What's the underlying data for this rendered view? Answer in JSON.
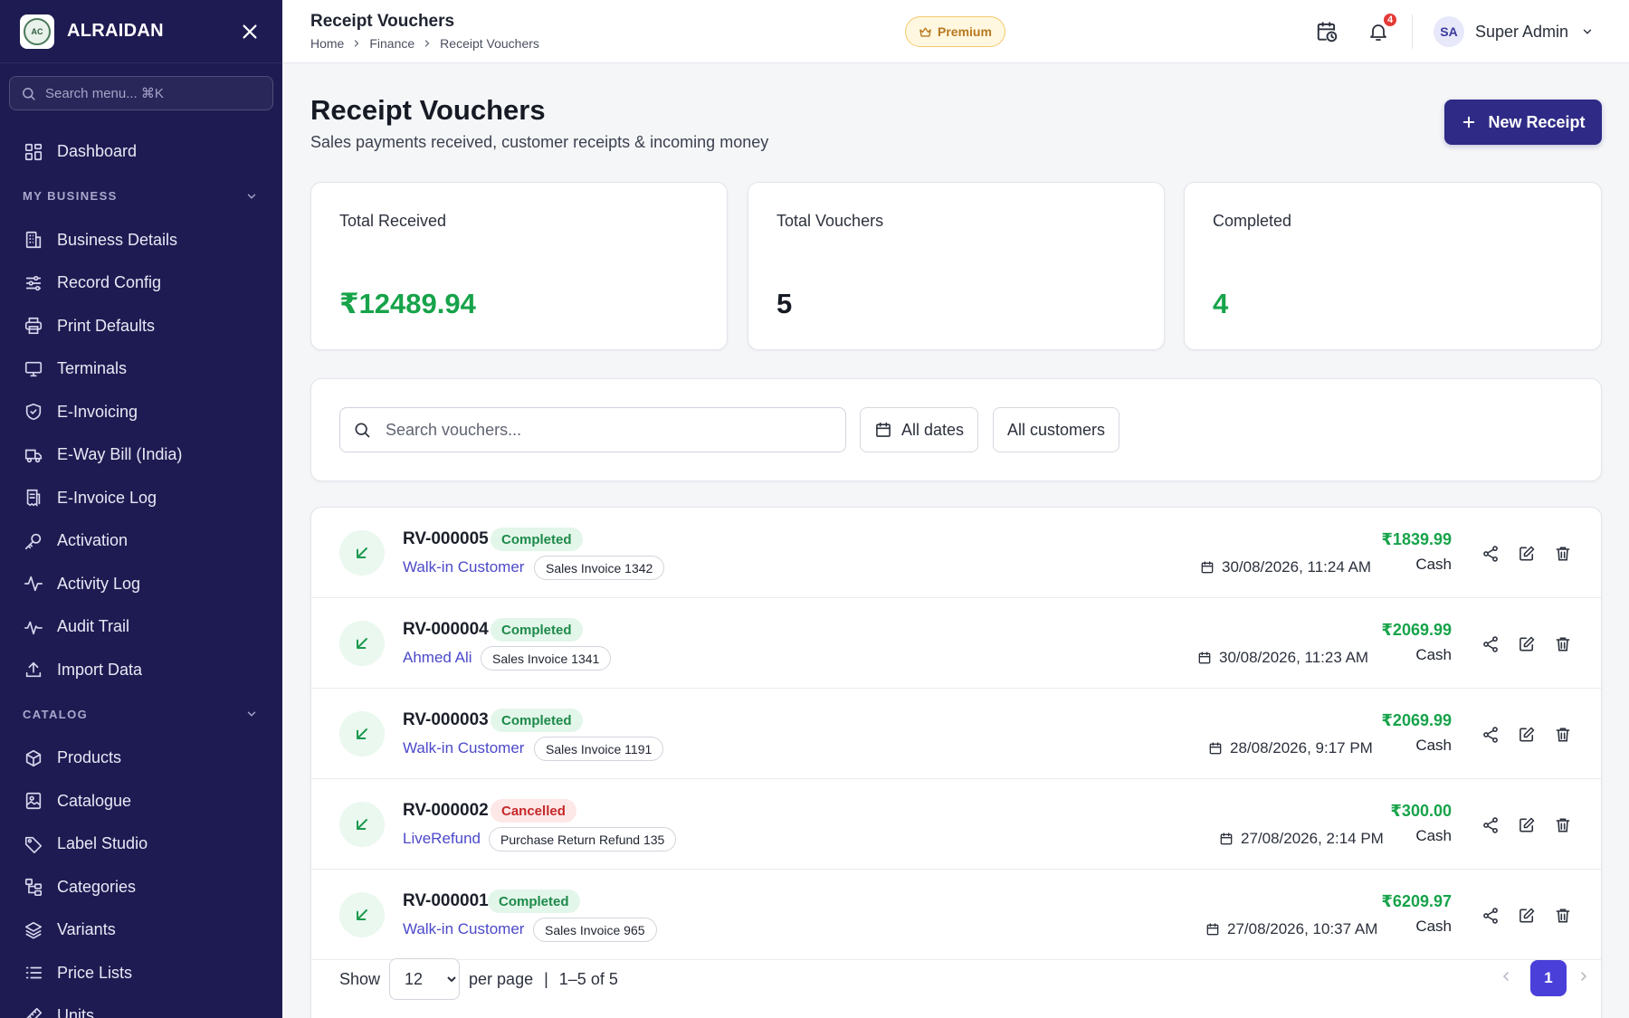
{
  "brand": {
    "name": "ALRAIDAN",
    "logo_text": "AC"
  },
  "sidebar": {
    "search_placeholder": "Search menu... ⌘K",
    "dashboard": "Dashboard",
    "sections": [
      {
        "title": "MY BUSINESS",
        "items": [
          "Business Details",
          "Record Config",
          "Print Defaults",
          "Terminals",
          "E-Invoicing",
          "E-Way Bill (India)",
          "E-Invoice Log",
          "Activation",
          "Activity Log",
          "Audit Trail",
          "Import Data"
        ]
      },
      {
        "title": "CATALOG",
        "items": [
          "Products",
          "Catalogue",
          "Label Studio",
          "Categories",
          "Variants",
          "Price Lists",
          "Units"
        ]
      }
    ]
  },
  "header": {
    "title": "Receipt Vouchers",
    "breadcrumb": [
      "Home",
      "Finance",
      "Receipt Vouchers"
    ],
    "premium": "Premium",
    "notifications": "4",
    "user": {
      "initials": "SA",
      "name": "Super Admin"
    }
  },
  "page": {
    "title": "Receipt Vouchers",
    "subtitle": "Sales payments received, customer receipts & incoming money",
    "new_button": "New Receipt"
  },
  "stats": [
    {
      "label": "Total Received",
      "value": "₹12489.94",
      "color": "#17a34a"
    },
    {
      "label": "Total Vouchers",
      "value": "5",
      "color": "#161a24"
    },
    {
      "label": "Completed",
      "value": "4",
      "color": "#17a34a"
    }
  ],
  "filters": {
    "search_placeholder": "Search vouchers...",
    "dates": "All dates",
    "customers": "All customers"
  },
  "vouchers": [
    {
      "id": "RV-000005",
      "status": "Completed",
      "customer": "Walk-in Customer",
      "ref": "Sales Invoice 1342",
      "date": "30/08/2026, 11:24 AM",
      "amount": "₹1839.99",
      "mode": "Cash"
    },
    {
      "id": "RV-000004",
      "status": "Completed",
      "customer": "Ahmed Ali",
      "ref": "Sales Invoice 1341",
      "date": "30/08/2026, 11:23 AM",
      "amount": "₹2069.99",
      "mode": "Cash"
    },
    {
      "id": "RV-000003",
      "status": "Completed",
      "customer": "Walk-in Customer",
      "ref": "Sales Invoice 1191",
      "date": "28/08/2026, 9:17 PM",
      "amount": "₹2069.99",
      "mode": "Cash"
    },
    {
      "id": "RV-000002",
      "status": "Cancelled",
      "customer": "LiveRefund",
      "ref": "Purchase Return Refund 135",
      "date": "27/08/2026, 2:14 PM",
      "amount": "₹300.00",
      "mode": "Cash"
    },
    {
      "id": "RV-000001",
      "status": "Completed",
      "customer": "Walk-in Customer",
      "ref": "Sales Invoice 965",
      "date": "27/08/2026, 10:37 AM",
      "amount": "₹6209.97",
      "mode": "Cash"
    }
  ],
  "pagination": {
    "show_label": "Show",
    "per_page_value": "12",
    "per_page_label": "per page",
    "separator": "|",
    "range": "1–5 of 5",
    "current_page": "1"
  },
  "colors": {
    "sidebar_bg": "#1e1b52",
    "primary": "#2e2a86",
    "success": "#17a34a",
    "danger": "#c62828",
    "link": "#4c49c9"
  }
}
